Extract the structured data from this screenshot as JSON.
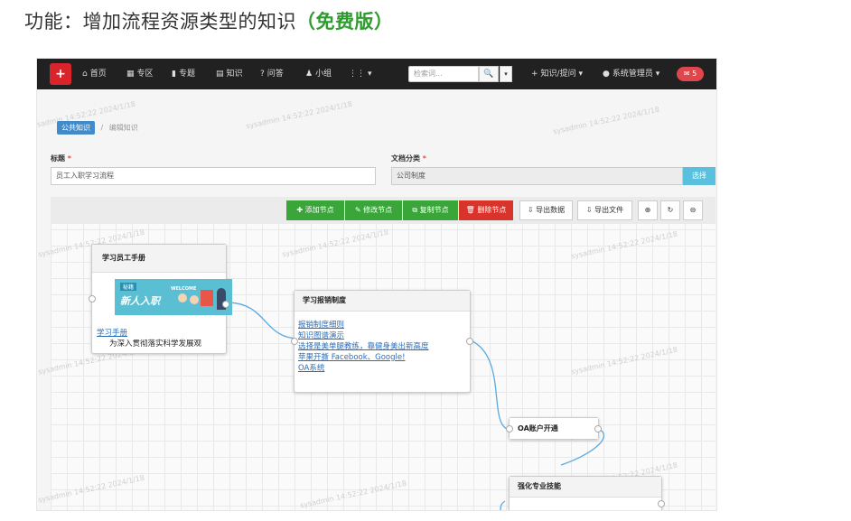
{
  "page_heading": {
    "prefix": "功能：增加流程资源类型的知识",
    "highlight": "（免费版）"
  },
  "navbar": {
    "logo_glyph": "+",
    "items": [
      {
        "icon": "home-icon",
        "glyph": "⌂",
        "label": "首页"
      },
      {
        "icon": "grid-icon",
        "glyph": "▦",
        "label": "专区"
      },
      {
        "icon": "bookmark-icon",
        "glyph": "▮",
        "label": "专题"
      },
      {
        "icon": "book-icon",
        "glyph": "▤",
        "label": "知识"
      },
      {
        "icon": "question-icon",
        "glyph": "?",
        "label": "问答"
      },
      {
        "icon": "group-icon",
        "glyph": "♟",
        "label": "小组"
      },
      {
        "icon": "apps-icon",
        "glyph": "⋮⋮",
        "label": "▾"
      },
      {
        "icon": "plus-icon",
        "glyph": "+",
        "label": "知识/提问 ▾"
      },
      {
        "icon": "user-icon",
        "glyph": "●",
        "label": "系统管理员 ▾"
      }
    ],
    "search_placeholder": "检索词...",
    "search_button": "🔍",
    "search_dropdown": "▾",
    "messages": "✉ 5"
  },
  "breadcrumb": {
    "root": "公共知识",
    "separator": "/",
    "current": "编辑知识"
  },
  "form": {
    "title_label": "标题",
    "title_value": "员工入职学习流程",
    "category_label": "文档分类",
    "category_value": "公司制度",
    "select_button": "选择",
    "required_mark": "*"
  },
  "toolbar": {
    "add_node": "✚ 添加节点",
    "edit_node": "✎ 修改节点",
    "copy_node": "⧉ 复制节点",
    "delete_node": "🗑 删除节点",
    "export_data": "⇩ 导出数据",
    "export_file": "⇩ 导出文件",
    "zoom_in": "⊕",
    "refresh": "↻",
    "zoom_out": "⊖"
  },
  "nodes": {
    "node1": {
      "title": "学习员工手册",
      "banner_tag": "秘籍",
      "banner_text": "新人入职",
      "banner_sign": "WELCOME",
      "link": "学习手册",
      "desc": "为深入贯彻落实科学发展观"
    },
    "node2": {
      "title": "学习报销制度",
      "links": [
        "报销制度细则",
        "知识图谱演示",
        "选择是美单腿教练，靠健身美出新高度",
        "苹果开撕 Facebook、Google!",
        "OA系统"
      ]
    },
    "node3": {
      "title": "OA账户开通"
    },
    "node4": {
      "title": "强化专业技能"
    }
  },
  "watermark": "sysadmin 14:52:22 2024/1/18",
  "colors": {
    "navbar": "#212121",
    "add_button": "#3aa63a",
    "delete_button": "#d9342b",
    "link": "#2a6ebb",
    "connector": "#5aa9e0",
    "badge": "#e0474c",
    "heading_highlight": "#2e9b2e"
  }
}
